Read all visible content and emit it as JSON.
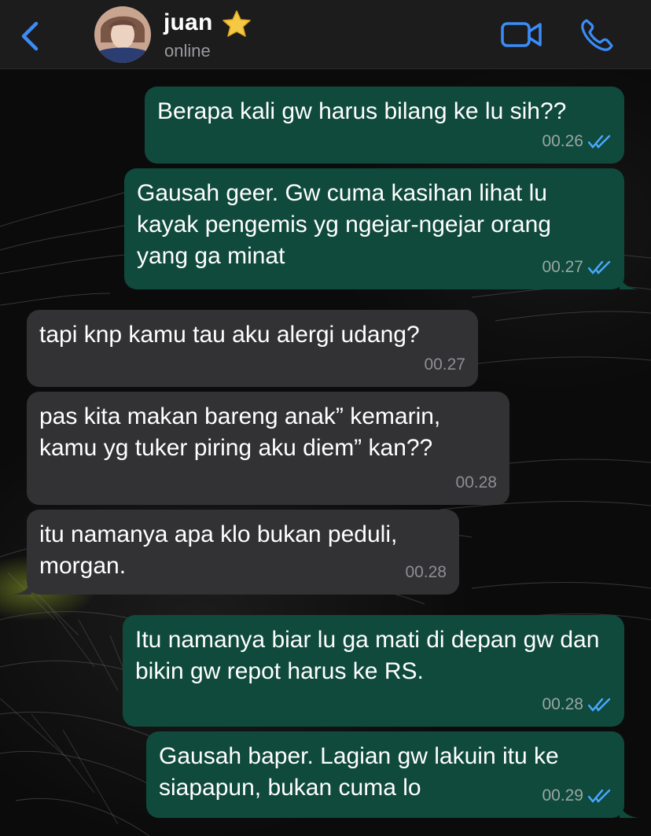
{
  "header": {
    "contact_name": "juan",
    "status": "online",
    "star_icon": "star-icon",
    "back_icon": "chevron-left-icon",
    "video_icon": "video-camera-icon",
    "call_icon": "phone-icon",
    "accent_color": "#3b8cf7"
  },
  "colors": {
    "outgoing_bubble": "#0f4a3d",
    "incoming_bubble": "#323234",
    "read_ticks": "#4aa8ff"
  },
  "messages": [
    {
      "direction": "out",
      "text": "Berapa kali gw harus bilang ke lu sih??",
      "time": "00.26",
      "read": true
    },
    {
      "direction": "out",
      "text": "Gausah geer. Gw cuma kasihan lihat lu kayak pengemis yg ngejar-ngejar orang yang ga minat",
      "time": "00.27",
      "read": true
    },
    {
      "direction": "in",
      "text": "tapi knp kamu tau aku alergi udang?",
      "time": "00.27"
    },
    {
      "direction": "in",
      "text": "pas kita makan bareng anak” kemarin, kamu yg tuker piring aku diem” kan??",
      "time": "00.28"
    },
    {
      "direction": "in",
      "text": "itu namanya apa klo bukan peduli, morgan.",
      "time": "00.28"
    },
    {
      "direction": "out",
      "text": "Itu namanya biar lu ga mati di depan gw dan bikin gw repot harus ke RS.",
      "time": "00.28",
      "read": true
    },
    {
      "direction": "out",
      "text": "Gausah baper. Lagian gw lakuin itu ke siapapun, bukan cuma lo",
      "time": "00.29",
      "read": true
    }
  ]
}
